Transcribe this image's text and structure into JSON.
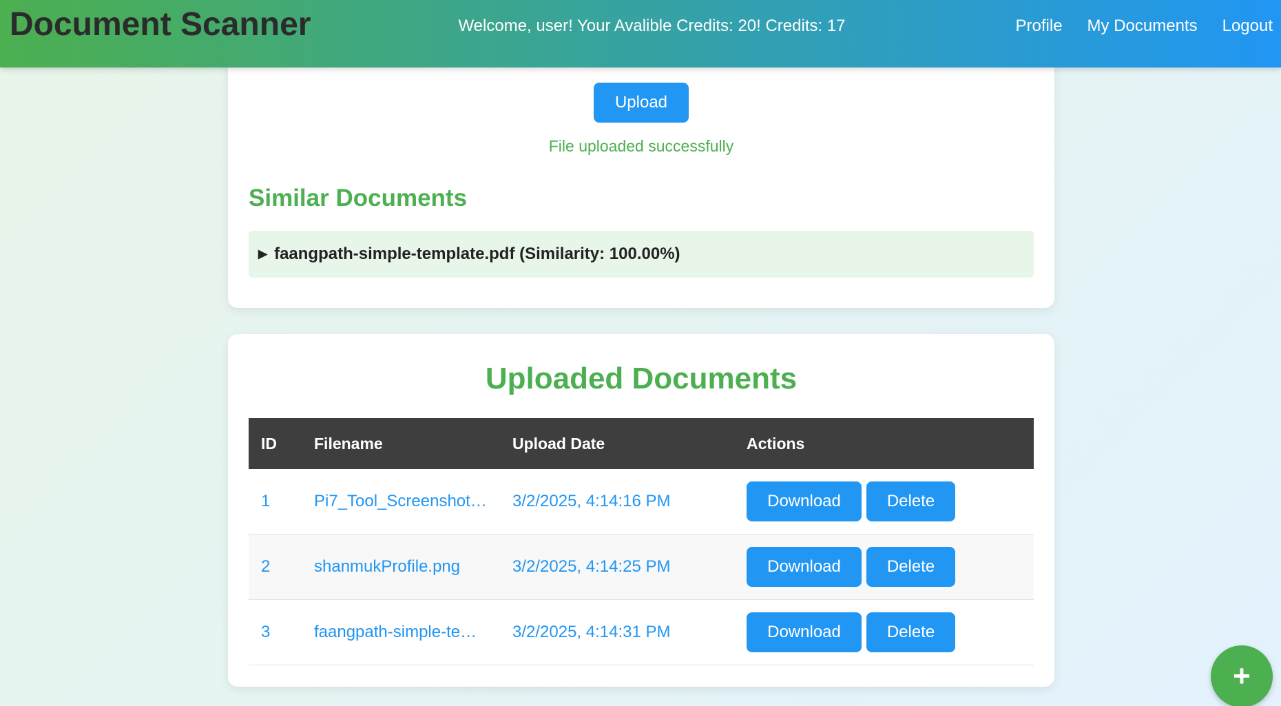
{
  "header": {
    "brand": "Document Scanner",
    "welcome": "Welcome, user! Your Avalible Credits: 20! Credits: 17",
    "nav": {
      "profile": "Profile",
      "my_documents": "My Documents",
      "logout": "Logout"
    }
  },
  "upload": {
    "button_label": "Upload",
    "status": "File uploaded successfully"
  },
  "similar": {
    "heading": "Similar Documents",
    "toggle_icon": "▶",
    "item": "faangpath-simple-template.pdf (Similarity: 100.00%)"
  },
  "uploaded": {
    "heading": "Uploaded Documents",
    "columns": {
      "id": "ID",
      "filename": "Filename",
      "date": "Upload Date",
      "actions": "Actions"
    },
    "rows": [
      {
        "id": "1",
        "filename": "Pi7_Tool_Screenshot…",
        "date": "3/2/2025, 4:14:16 PM",
        "download": "Download",
        "delete": "Delete"
      },
      {
        "id": "2",
        "filename": "shanmukProfile.png",
        "date": "3/2/2025, 4:14:25 PM",
        "download": "Download",
        "delete": "Delete"
      },
      {
        "id": "3",
        "filename": "faangpath-simple-te…",
        "date": "3/2/2025, 4:14:31 PM",
        "download": "Download",
        "delete": "Delete"
      }
    ]
  },
  "fab": {
    "icon": "plus-icon",
    "symbol": "+"
  },
  "colors": {
    "green": "#4caf50",
    "blue": "#2196f3",
    "table_header": "#3e3e3e",
    "similar_bg": "#e8f5e9"
  }
}
